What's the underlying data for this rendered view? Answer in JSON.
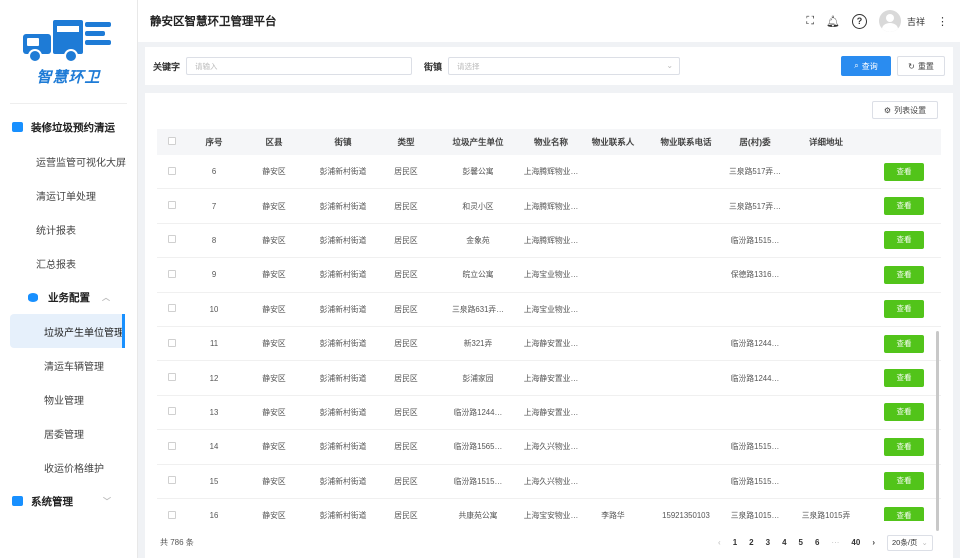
{
  "brand": {
    "logo_text": "智慧环卫",
    "accent": "#1e7bd6"
  },
  "header": {
    "title": "静安区智慧环卫管理平台",
    "fullscreen_icon": "fullscreen-icon",
    "bell_icon": "bell-icon",
    "help_label": "?",
    "user_name": "吉祥",
    "more_label": "⋮"
  },
  "sidebar": {
    "group1": {
      "label": "装修垃圾预约清运"
    },
    "items1": [
      {
        "label": "运营监管可视化大屏"
      },
      {
        "label": "清运订单处理"
      },
      {
        "label": "统计报表"
      },
      {
        "label": "汇总报表"
      }
    ],
    "sub": {
      "label": "业务配置"
    },
    "items2": [
      {
        "label": "垃圾产生单位管理"
      },
      {
        "label": "清运车辆管理"
      },
      {
        "label": "物业管理"
      },
      {
        "label": "居委管理"
      },
      {
        "label": "收运价格维护"
      }
    ],
    "group2": {
      "label": "系统管理"
    }
  },
  "filter": {
    "keyword_label": "关键字",
    "keyword_placeholder": "请输入",
    "street_label": "街镇",
    "street_placeholder": "请选择",
    "query_label": "查询",
    "reset_label": "重置"
  },
  "panel": {
    "column_settings_label": "列表设置"
  },
  "table": {
    "columns": [
      "序号",
      "区县",
      "街镇",
      "类型",
      "垃圾产生单位",
      "物业名称",
      "物业联系人",
      "物业联系电话",
      "居(村)委",
      "详细地址"
    ],
    "view_label": "查看",
    "rows": [
      [
        "6",
        "静安区",
        "彭浦新村街道",
        "居民区",
        "彭馨公寓",
        "上海腾辉物业…",
        "",
        "",
        "三泉路517弄…",
        ""
      ],
      [
        "7",
        "静安区",
        "彭浦新村街道",
        "居民区",
        "和灵小区",
        "上海腾辉物业…",
        "",
        "",
        "三泉路517弄…",
        ""
      ],
      [
        "8",
        "静安区",
        "彭浦新村街道",
        "居民区",
        "金象苑",
        "上海腾辉物业…",
        "",
        "",
        "临汾路1515…",
        ""
      ],
      [
        "9",
        "静安区",
        "彭浦新村街道",
        "居民区",
        "皖立公寓",
        "上海宝业物业…",
        "",
        "",
        "保德路1316…",
        ""
      ],
      [
        "10",
        "静安区",
        "彭浦新村街道",
        "居民区",
        "三泉路631弄…",
        "上海宝业物业…",
        "",
        "",
        "",
        ""
      ],
      [
        "11",
        "静安区",
        "彭浦新村街道",
        "居民区",
        "新321弄",
        "上海静安置业…",
        "",
        "",
        "临汾路1244…",
        ""
      ],
      [
        "12",
        "静安区",
        "彭浦新村街道",
        "居民区",
        "彭浦家园",
        "上海静安置业…",
        "",
        "",
        "临汾路1244…",
        ""
      ],
      [
        "13",
        "静安区",
        "彭浦新村街道",
        "居民区",
        "临汾路1244…",
        "上海静安置业…",
        "",
        "",
        "",
        ""
      ],
      [
        "14",
        "静安区",
        "彭浦新村街道",
        "居民区",
        "临汾路1565…",
        "上海久兴物业…",
        "",
        "",
        "临汾路1515…",
        ""
      ],
      [
        "15",
        "静安区",
        "彭浦新村街道",
        "居民区",
        "临汾路1515…",
        "上海久兴物业…",
        "",
        "",
        "临汾路1515…",
        ""
      ],
      [
        "16",
        "静安区",
        "彭浦新村街道",
        "居民区",
        "共康苑公寓",
        "上海宝安物业…",
        "李路华",
        "15921350103",
        "三泉路1015…",
        "三泉路1015弄"
      ]
    ]
  },
  "footer": {
    "total": "共 786 条",
    "prev": "‹",
    "pages": [
      "1",
      "2",
      "3",
      "4",
      "5",
      "6"
    ],
    "ellipsis": "···",
    "last_page": "40",
    "next": "›",
    "page_size": "20条/页"
  }
}
